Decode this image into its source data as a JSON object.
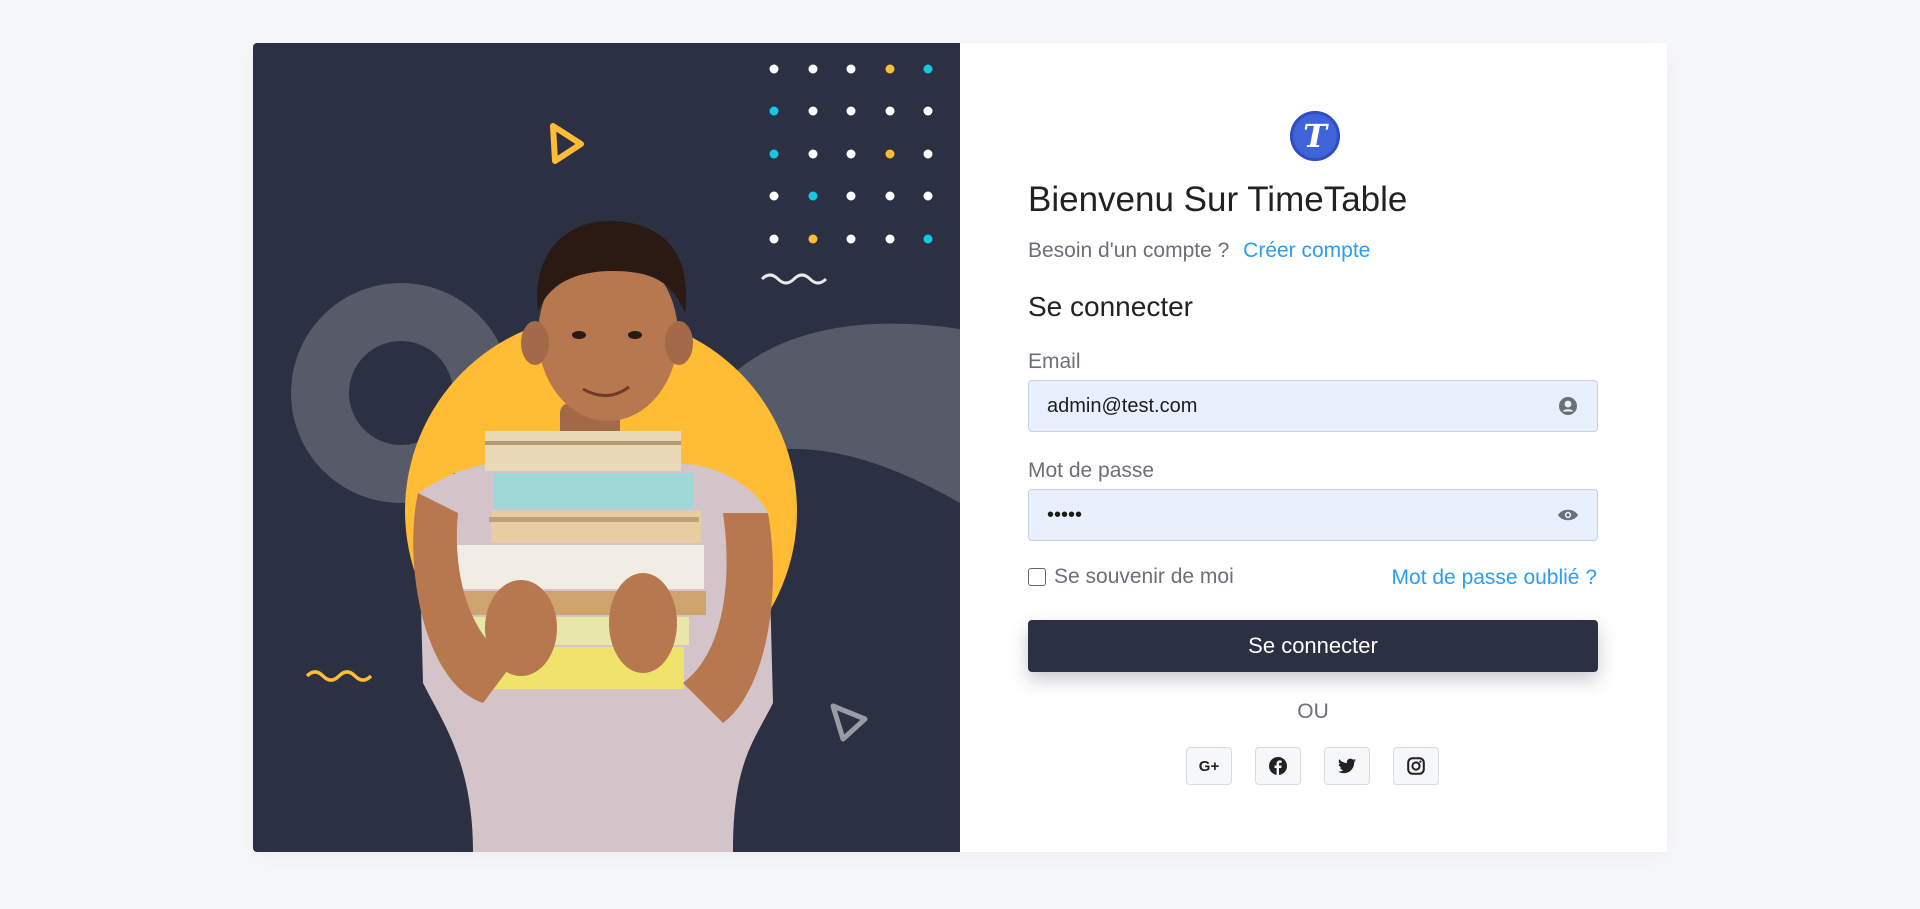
{
  "hero": {
    "image_description": "boy-holding-books"
  },
  "brand": {
    "logo_letter": "T",
    "color": "#3f63d9"
  },
  "title": "Bienvenu Sur TimeTable",
  "subtitle": {
    "text": "Besoin d'un compte ?",
    "link": "Créer compte"
  },
  "form": {
    "heading": "Se connecter",
    "email_label": "Email",
    "email_value": "admin@test.com",
    "password_label": "Mot de passe",
    "password_value": "•••••",
    "remember_label": "Se souvenir de moi",
    "forgot_label": "Mot de passe oublié ?",
    "submit_label": "Se connecter",
    "or_label": "OU"
  },
  "social": [
    {
      "name": "google-plus-icon",
      "glyph": "G+"
    },
    {
      "name": "facebook-icon"
    },
    {
      "name": "twitter-icon"
    },
    {
      "name": "instagram-icon"
    }
  ],
  "colors": {
    "dark": "#2b3042",
    "accent": "#ffbc34",
    "link": "#2a9df4",
    "input_bg": "#e8f0fe"
  }
}
